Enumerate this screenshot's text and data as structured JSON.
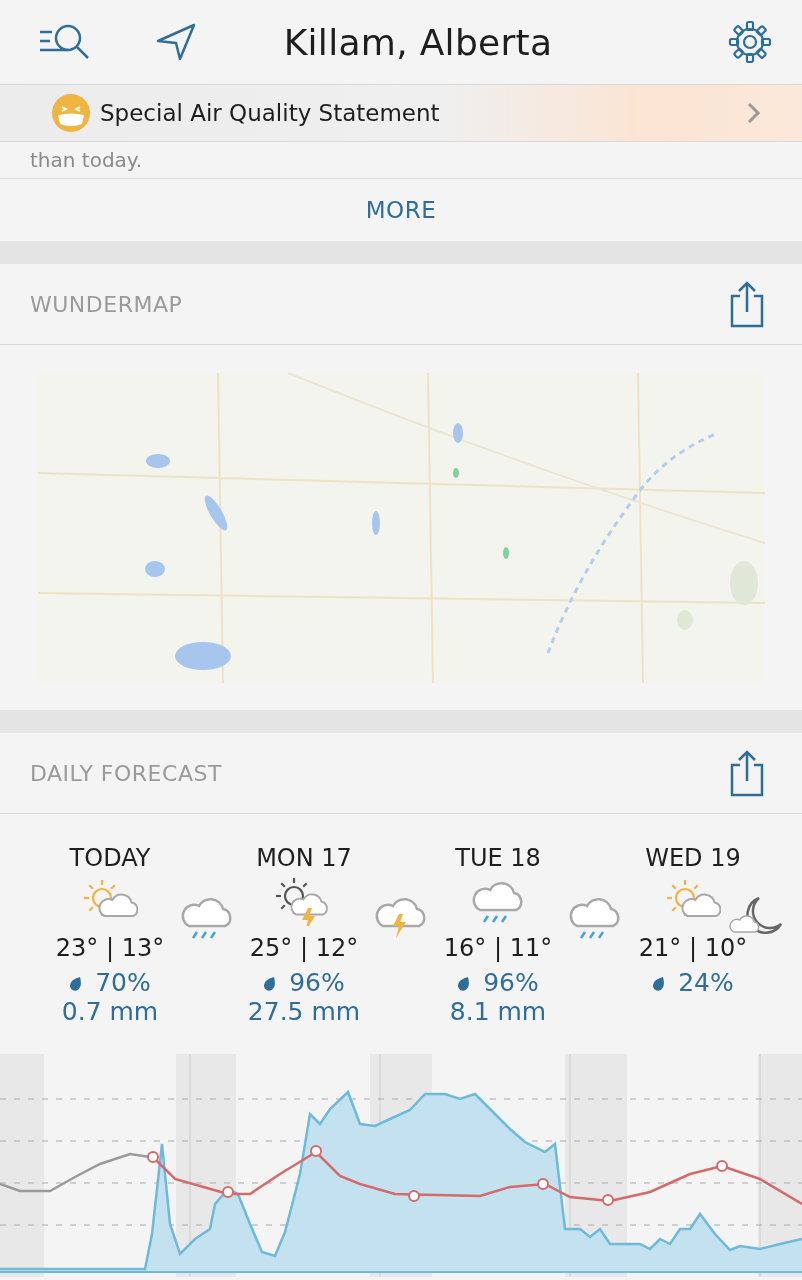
{
  "header": {
    "title": "Killam, Alberta"
  },
  "alert": {
    "text": "Special Air Quality Statement"
  },
  "summary": {
    "text": "than today."
  },
  "more_button": {
    "label": "MORE"
  },
  "wundermap": {
    "title": "WUNDERMAP"
  },
  "daily_forecast": {
    "title": "DAILY FORECAST",
    "items": [
      {
        "kind": "partly-sunny",
        "label": "TODAY",
        "temps": "23° | 13°",
        "chance": "70%",
        "amount": "0.7 mm"
      },
      {
        "kind": "rain"
      },
      {
        "kind": "sun-thunder",
        "label": "MON 17",
        "temps": "25° | 12°",
        "chance": "96%",
        "amount": "27.5 mm"
      },
      {
        "kind": "thunder"
      },
      {
        "kind": "rain",
        "label": "TUE 18",
        "temps": "16° | 11°",
        "chance": "96%",
        "amount": "8.1 mm"
      },
      {
        "kind": "rain"
      },
      {
        "kind": "partly-sunny",
        "label": "WED 19",
        "temps": "21° | 10°",
        "chance": "24%"
      },
      {
        "kind": "moon-cloud"
      }
    ]
  }
}
